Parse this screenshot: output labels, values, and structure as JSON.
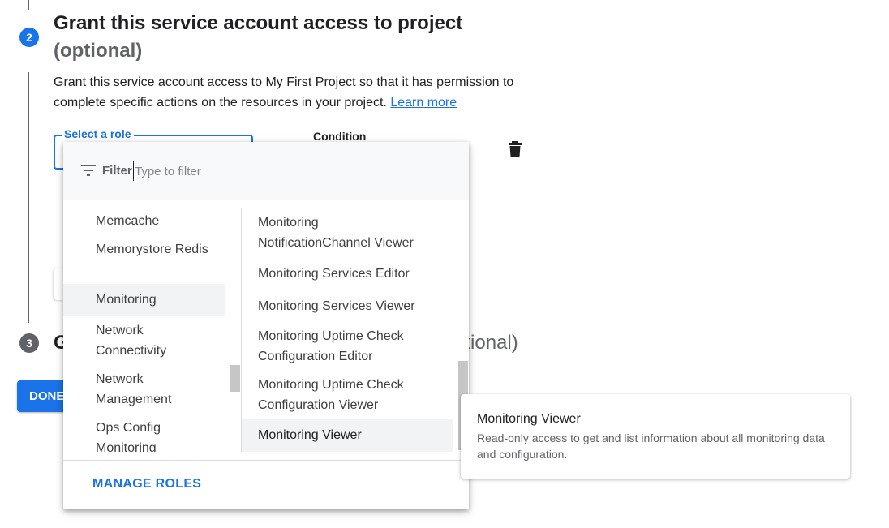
{
  "step2": {
    "number": "2",
    "title": "Grant this service account access to project",
    "optional": "(optional)",
    "description": "Grant this service account access to My First Project so that it has permission to complete specific actions on the resources in your project.",
    "learn_more": "Learn more"
  },
  "role_field": {
    "label": "Select a role",
    "condition_label": "Condition"
  },
  "dropdown": {
    "filter_label": "Filter",
    "filter_placeholder": "Type to filter",
    "left_items": [
      "Memcache",
      "Memorystore Redis",
      "Monitoring",
      "Network Connectivity",
      "Network Management",
      "Ops Config Monitoring"
    ],
    "left_selected": "Monitoring",
    "right_items": [
      "Monitoring NotificationChannel Viewer",
      "Monitoring Services Editor",
      "Monitoring Services Viewer",
      "Monitoring Uptime Check Configuration Editor",
      "Monitoring Uptime Check Configuration Viewer",
      "Monitoring Viewer"
    ],
    "right_selected": "Monitoring Viewer",
    "manage_roles": "MANAGE ROLES"
  },
  "step3": {
    "number": "3",
    "title_visible_start": "G",
    "title_visible_end": "ptional)"
  },
  "done_button": "DONE",
  "tooltip": {
    "title": "Monitoring Viewer",
    "body": "Read-only access to get and list information about all monitoring data and configuration."
  },
  "colors": {
    "accent": "#1a73e8",
    "text": "#202124",
    "muted": "#5f6368",
    "selected_bg": "#f1f3f4"
  },
  "icons": [
    "filter-icon",
    "trash-icon"
  ]
}
